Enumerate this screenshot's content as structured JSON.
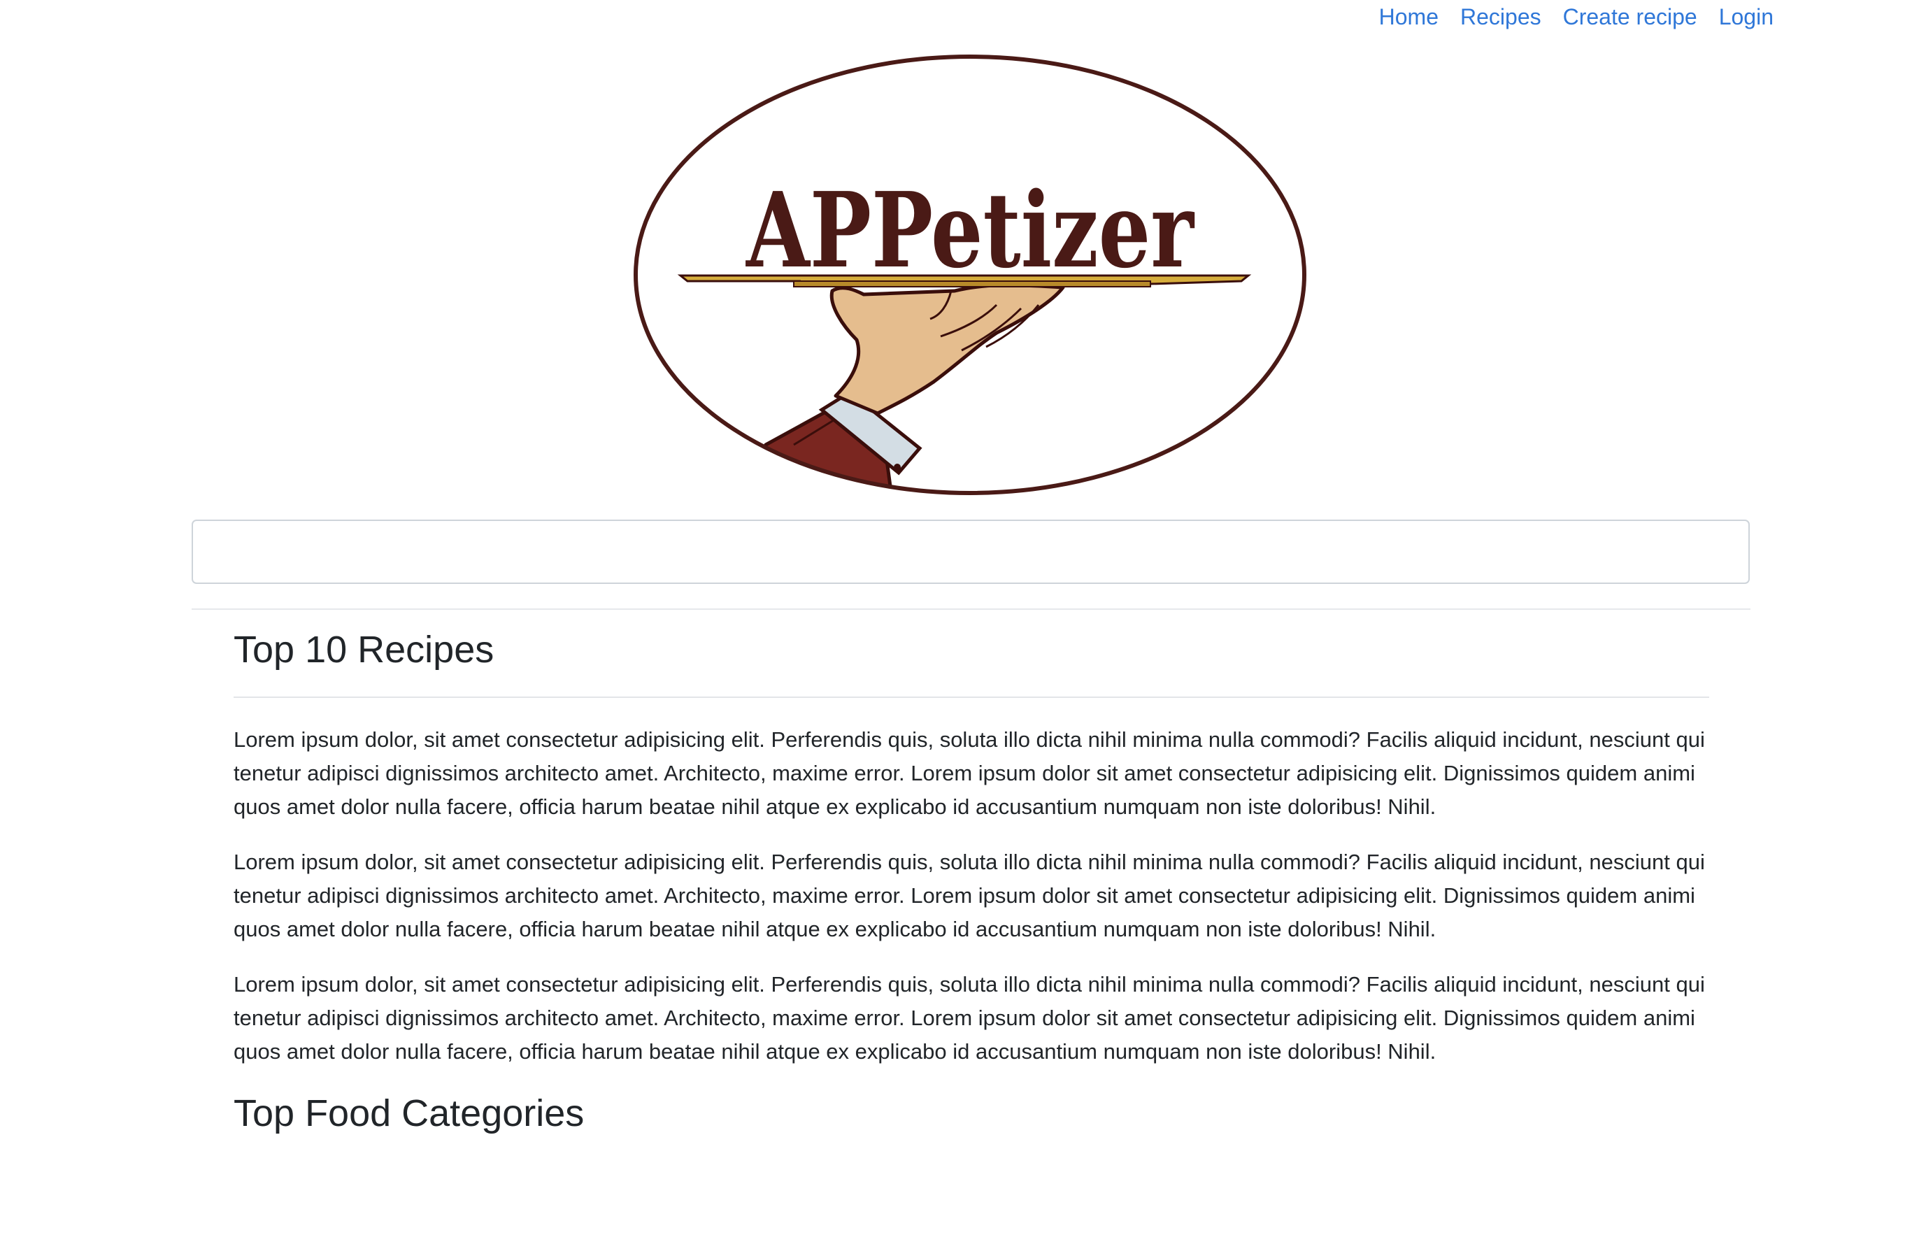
{
  "nav": {
    "items": [
      {
        "label": "Home"
      },
      {
        "label": "Recipes"
      },
      {
        "label": "Create recipe"
      },
      {
        "label": "Login"
      }
    ]
  },
  "logo": {
    "text": "APPetizer",
    "colors": {
      "ring": "#4a1a16",
      "text": "#4a1a16",
      "tray": "#d6ad3c",
      "hand": "#e5bd8e",
      "cuff": "#d3dde4",
      "sleeve": "#7a2620"
    }
  },
  "search": {
    "value": "",
    "placeholder": ""
  },
  "sections": {
    "top_recipes": {
      "title": "Top 10 Recipes",
      "paragraphs": [
        "Lorem ipsum dolor, sit amet consectetur adipisicing elit. Perferendis quis, soluta illo dicta nihil minima nulla commodi? Facilis aliquid incidunt, nesciunt qui tenetur adipisci dignissimos architecto amet. Architecto, maxime error. Lorem ipsum dolor sit amet consectetur adipisicing elit. Dignissimos quidem animi quos amet dolor nulla facere, officia harum beatae nihil atque ex explicabo id accusantium numquam non iste doloribus! Nihil.",
        "Lorem ipsum dolor, sit amet consectetur adipisicing elit. Perferendis quis, soluta illo dicta nihil minima nulla commodi? Facilis aliquid incidunt, nesciunt qui tenetur adipisci dignissimos architecto amet. Architecto, maxime error. Lorem ipsum dolor sit amet consectetur adipisicing elit. Dignissimos quidem animi quos amet dolor nulla facere, officia harum beatae nihil atque ex explicabo id accusantium numquam non iste doloribus! Nihil.",
        "Lorem ipsum dolor, sit amet consectetur adipisicing elit. Perferendis quis, soluta illo dicta nihil minima nulla commodi? Facilis aliquid incidunt, nesciunt qui tenetur adipisci dignissimos architecto amet. Architecto, maxime error. Lorem ipsum dolor sit amet consectetur adipisicing elit. Dignissimos quidem animi quos amet dolor nulla facere, officia harum beatae nihil atque ex explicabo id accusantium numquam non iste doloribus! Nihil."
      ]
    },
    "top_categories": {
      "title": "Top Food Categories"
    }
  },
  "theme": {
    "link_color": "#2f77d8",
    "text_color": "#212529"
  }
}
